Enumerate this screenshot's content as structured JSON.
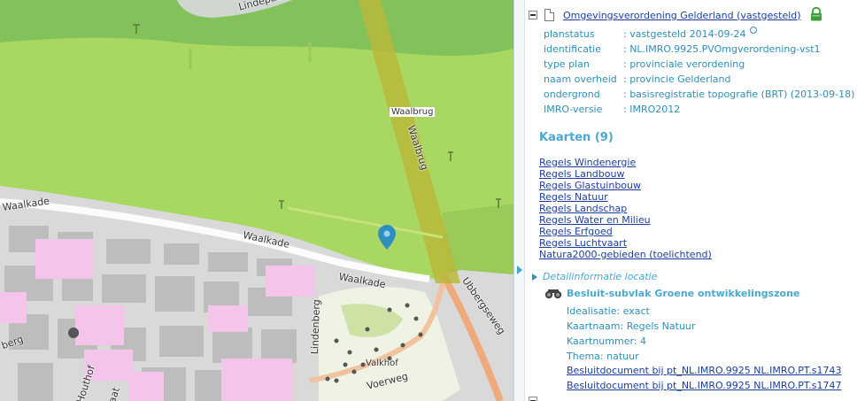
{
  "map": {
    "labels": {
      "lindepad": "Lindepad",
      "waalbrug_horizontal": "Waalbrug",
      "waalbrug_vertical": "Waalbrug",
      "waalkade_left": "Waalkade",
      "waalkade_mid": "Waalkade",
      "waalkade_low": "Waalkade",
      "ubbergseweg": "Ubbergseweg",
      "lindenberg": "Lindenberg",
      "valkhof": "Valkhof",
      "voerweg": "Voerweg",
      "houthof": "Houthof",
      "berg_left": "berg",
      "aat": "aat"
    },
    "marker_icon": "map-pin-icon",
    "colors": {
      "green_light": "#a9d862",
      "green_dark": "#7ec05b",
      "bridge": "#b9b83a",
      "urban_gray": "#d6d6d6",
      "building_gray": "#c2c2c2",
      "pink": "#f5c4ea",
      "marker": "#2f8ec0"
    }
  },
  "panel": {
    "plan_title": "Omgevingsverordening Gelderland (vastgesteld)",
    "metadata": [
      {
        "key": "planstatus",
        "value": ": vastgesteld 2014-09-24",
        "info_icon": true
      },
      {
        "key": "identificatie",
        "value": ": NL.IMRO.9925.PVOmgverordening-vst1"
      },
      {
        "key": "type plan",
        "value": ": provinciale verordening"
      },
      {
        "key": "naam overheid",
        "value": ": provincie Gelderland"
      },
      {
        "key": "ondergrond",
        "value": ": basisregistratie topografie (BRT) (2013-09-18)"
      },
      {
        "key": "IMRO-versie",
        "value": ": IMRO2012"
      }
    ],
    "kaarten_title": "Kaarten (9)",
    "kaarten": [
      "Regels Windenergie",
      "Regels Landbouw",
      "Regels Glastuinbouw",
      "Regels Natuur",
      "Regels Landschap",
      "Regels Water en Milieu",
      "Regels Erfgoed",
      "Regels Luchtvaart",
      "Natura2000-gebieden (toelichtend)"
    ],
    "detail_title": "Detailinformatie locatie",
    "besluit_title": "Besluit-subvlak Groene ontwikkelingszone",
    "besluit_meta": [
      "Idealisatie: exact",
      "Kaartnaam: Regels Natuur",
      "Kaartnummer: 4",
      "Thema: natuur"
    ],
    "besluit_links": [
      "Besluitdocument bij pt_NL.IMRO.9925 NL.IMRO.PT.s1743",
      "Besluitdocument bij pt_NL.IMRO.9925 NL.IMRO.PT.s1747"
    ],
    "colors": {
      "link": "#1a3f9e",
      "meta_text": "#2e8fb6",
      "heading": "#4aa9d1",
      "lock": "#3aa03a"
    }
  }
}
